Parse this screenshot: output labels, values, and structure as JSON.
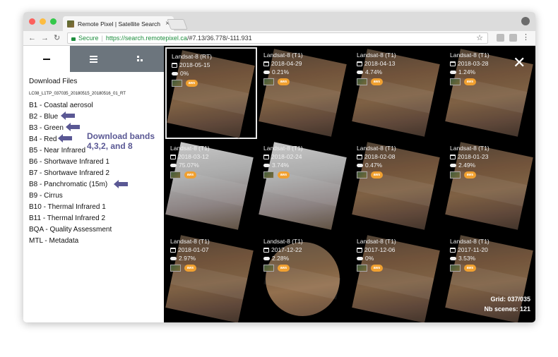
{
  "browser": {
    "tab_title": "Remote Pixel | Satellite Search",
    "tab_close": "×",
    "secure_label": "Secure",
    "url_scheme": "https://",
    "url_host": "search.remotepixel.ca",
    "url_path": "/#7.13/36.778/-111.931",
    "nav_back": "←",
    "nav_forward": "→",
    "nav_reload": "↻",
    "star": "☆",
    "menu": "⋮",
    "traffic_lights": [
      "#fc605c",
      "#fdbc40",
      "#34c84a"
    ]
  },
  "sidebar": {
    "tabs": [
      {
        "name": "download",
        "icon": "minus-icon",
        "active": true
      },
      {
        "name": "list",
        "icon": "list-icon",
        "active": false
      },
      {
        "name": "grid",
        "icon": "grid-icon",
        "active": false
      }
    ],
    "title": "Download Files",
    "scene_id": "LC08_L1TP_037035_20180515_20180516_01_RT",
    "bands": [
      "B1 - Coastal aerosol",
      "B2 - Blue",
      "B3 - Green",
      "B4 - Red",
      "B5 - Near Infrared",
      "B6 - Shortwave Infrared 1",
      "B7 - Shortwave Infrared 2",
      "B8 - Panchromatic (15m)",
      "B9 - Cirrus",
      "B10 - Thermal Infrared 1",
      "B11 - Thermal Infrared 2",
      "BQA - Quality Assessment",
      "MTL - Metadata"
    ],
    "annotation_line1": "Download bands",
    "annotation_line2": "4,3,2, and 8",
    "annotation_color": "#5a5894"
  },
  "grid": {
    "close": "✕",
    "aws_badge": "aws",
    "scenes": [
      {
        "sensor": "Landsat-8 (RT)",
        "date": "2018-05-15",
        "cloud": "0%",
        "selected": true,
        "look": "normal"
      },
      {
        "sensor": "Landsat-8 (T1)",
        "date": "2018-04-29",
        "cloud": "0.21%",
        "selected": false,
        "look": "normal"
      },
      {
        "sensor": "Landsat-8 (T1)",
        "date": "2018-04-13",
        "cloud": "4.74%",
        "selected": false,
        "look": "normal"
      },
      {
        "sensor": "Landsat-8 (T1)",
        "date": "2018-03-28",
        "cloud": "1.24%",
        "selected": false,
        "look": "normal"
      },
      {
        "sensor": "Landsat-8 (T1)",
        "date": "2018-03-12",
        "cloud": "75.07%",
        "selected": false,
        "look": "cloudy"
      },
      {
        "sensor": "Landsat-8 (T1)",
        "date": "2018-02-24",
        "cloud": "3.74%",
        "selected": false,
        "look": "cloudy"
      },
      {
        "sensor": "Landsat-8 (T1)",
        "date": "2018-02-08",
        "cloud": "0.47%",
        "selected": false,
        "look": "normal"
      },
      {
        "sensor": "Landsat-8 (T1)",
        "date": "2018-01-23",
        "cloud": "2.49%",
        "selected": false,
        "look": "normal"
      },
      {
        "sensor": "Landsat-8 (T1)",
        "date": "2018-01-07",
        "cloud": "2.97%",
        "selected": false,
        "look": "normal"
      },
      {
        "sensor": "Landsat-8 (T1)",
        "date": "2017-12-22",
        "cloud": "2.28%",
        "selected": false,
        "look": "light"
      },
      {
        "sensor": "Landsat-8 (T1)",
        "date": "2017-12-06",
        "cloud": "0%",
        "selected": false,
        "look": "normal"
      },
      {
        "sensor": "Landsat-8 (T1)",
        "date": "2017-11-20",
        "cloud": "3.53%",
        "selected": false,
        "look": "normal"
      }
    ],
    "grid_label": "Grid: 037/035",
    "nb_scenes_label": "Nb scenes: 121"
  }
}
